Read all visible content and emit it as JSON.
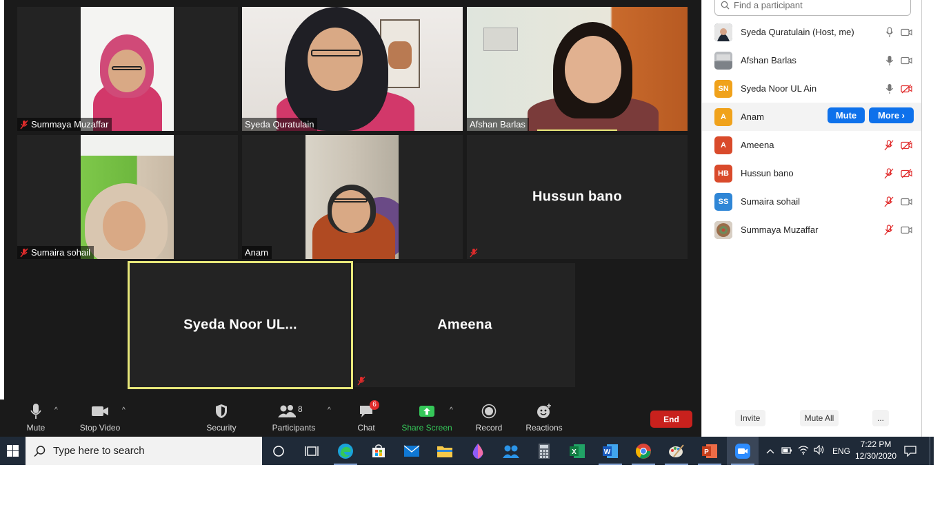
{
  "meeting": {
    "tiles": [
      {
        "name": "Summaya Muzaffar",
        "muted": true
      },
      {
        "name": "Syeda Quratulain",
        "muted": false
      },
      {
        "name": "Afshan Barlas",
        "muted": false
      },
      {
        "name": "Sumaira sohail",
        "muted": true
      },
      {
        "name": "Anam",
        "muted": false
      },
      {
        "name": "Hussun bano",
        "muted": true
      },
      {
        "name": "Syeda Noor UL...",
        "muted": false
      },
      {
        "name": "Ameena",
        "muted": true
      }
    ]
  },
  "toolbar": {
    "mute": "Mute",
    "stop_video": "Stop Video",
    "security": "Security",
    "participants": "Participants",
    "participants_count": "8",
    "chat": "Chat",
    "chat_badge": "6",
    "share_screen": "Share Screen",
    "record": "Record",
    "reactions": "Reactions",
    "end": "End"
  },
  "panel": {
    "search_placeholder": "Find a participant",
    "participants": [
      {
        "name": "Syeda Quratulain (Host, me)",
        "initials": "",
        "avatar_color": "#3b4a5a",
        "mic": "on",
        "video": "on"
      },
      {
        "name": "Afshan Barlas",
        "initials": "",
        "avatar_color": "#8a8f96",
        "mic": "on",
        "video": "on"
      },
      {
        "name": "Syeda Noor UL Ain",
        "initials": "SN",
        "avatar_color": "#f0a21b",
        "mic": "on",
        "video": "off"
      },
      {
        "name": "Anam",
        "initials": "A",
        "avatar_color": "#f0a21b",
        "mic": "on",
        "video": "on"
      },
      {
        "name": "Ameena",
        "initials": "A",
        "avatar_color": "#d94a2b",
        "mic": "off",
        "video": "off"
      },
      {
        "name": "Hussun bano",
        "initials": "HB",
        "avatar_color": "#d94a2b",
        "mic": "off",
        "video": "off"
      },
      {
        "name": "Sumaira sohail",
        "initials": "SS",
        "avatar_color": "#2f86d6",
        "mic": "off",
        "video": "on"
      },
      {
        "name": "Summaya Muzaffar",
        "initials": "",
        "avatar_color": "#9a8a7a",
        "mic": "off",
        "video": "on"
      }
    ],
    "hover_mute": "Mute",
    "hover_more": "More ›",
    "invite": "Invite",
    "mute_all": "Mute All",
    "more_options": "..."
  },
  "taskbar": {
    "search_placeholder": "Type here to search",
    "language": "ENG",
    "time": "7:22 PM",
    "date": "12/30/2020"
  },
  "colors": {
    "zoom_blue": "#0e71eb",
    "end_red": "#c8211d",
    "share_green": "#35c759",
    "muted_red": "#e02b2b",
    "active_speaker": "#e8e87a"
  }
}
